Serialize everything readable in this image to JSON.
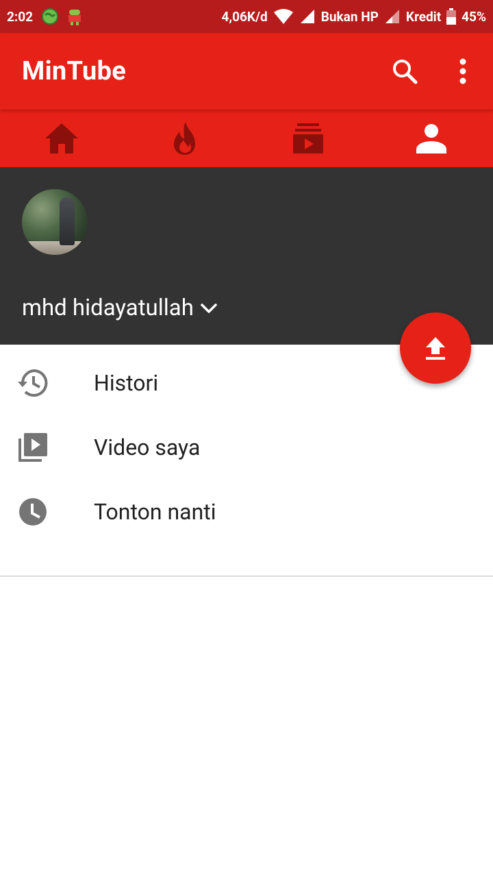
{
  "status_bar": {
    "time": "2:02",
    "speed": "4,06K/d",
    "carrier1": "Bukan HP",
    "carrier2": "Kredit",
    "battery": "45%"
  },
  "app_bar": {
    "title": "MinTube",
    "search_icon": "search-icon",
    "more_icon": "more-vert-icon"
  },
  "tabs": [
    {
      "icon": "home-icon"
    },
    {
      "icon": "trending-icon"
    },
    {
      "icon": "subscriptions-icon"
    },
    {
      "icon": "account-icon"
    }
  ],
  "profile": {
    "name": "mhd hidayatullah"
  },
  "fab": {
    "icon": "upload-icon"
  },
  "menu": {
    "items": [
      {
        "label": "Histori",
        "icon": "history-icon"
      },
      {
        "label": "Video saya",
        "icon": "video-library-icon"
      },
      {
        "label": "Tonton nanti",
        "icon": "watch-later-icon"
      }
    ]
  },
  "colors": {
    "primary": "#e62117",
    "primary_dark": "#b71c1c",
    "tab_icon_inactive": "#8b0f0a",
    "header_bg": "#333333",
    "menu_icon": "#757575"
  }
}
